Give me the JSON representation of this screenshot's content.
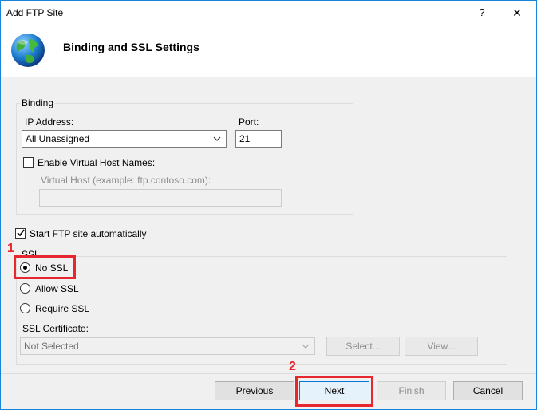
{
  "window": {
    "title": "Add FTP Site",
    "help_glyph": "?",
    "close_glyph": "✕"
  },
  "header": {
    "title": "Binding and SSL Settings",
    "icon": "globe-icon"
  },
  "binding": {
    "group_label": "Binding",
    "ip_label": "IP Address:",
    "ip_value": "All Unassigned",
    "port_label": "Port:",
    "port_value": "21",
    "virtual_host_checkbox": "Enable Virtual Host Names:",
    "virtual_host_checked": false,
    "virtual_host_label": "Virtual Host (example: ftp.contoso.com):",
    "virtual_host_value": ""
  },
  "start_auto": {
    "label": "Start FTP site automatically",
    "checked": true
  },
  "ssl": {
    "group_label": "SSL",
    "options": [
      {
        "label": "No SSL",
        "selected": true
      },
      {
        "label": "Allow SSL",
        "selected": false
      },
      {
        "label": "Require SSL",
        "selected": false
      }
    ],
    "cert_label": "SSL Certificate:",
    "cert_value": "Not Selected",
    "select_button": "Select...",
    "view_button": "View..."
  },
  "footer": {
    "previous": "Previous",
    "next": "Next",
    "finish": "Finish",
    "cancel": "Cancel"
  },
  "annotations": {
    "marker1": "1",
    "marker2": "2",
    "color": "#e8262e"
  }
}
